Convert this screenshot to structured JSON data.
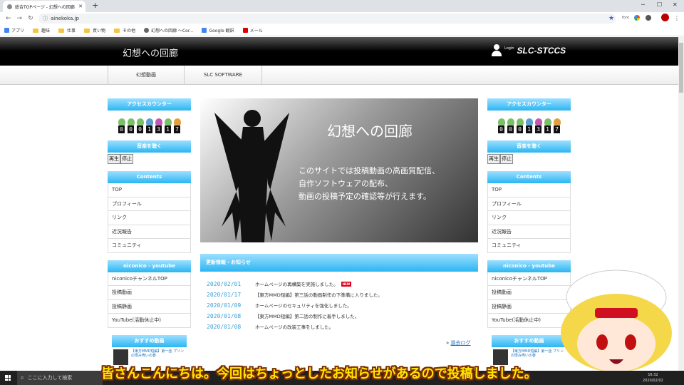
{
  "browser": {
    "tab_title": "総合TOPページ - 幻想への回廊",
    "url": "ainekoka.jp",
    "bookmarks": [
      "アプリ",
      "趣味",
      "仕事",
      "買い物",
      "その他",
      "幻想への回廊 〜Cor...",
      "Google 翻訳",
      "メール"
    ],
    "extension_text": "font"
  },
  "header": {
    "site_title": "幻想への回廊",
    "login_label": "Login",
    "username": "SLC-STCCS"
  },
  "nav": [
    "幻想動画",
    "SLC SOFTWARE"
  ],
  "sidebar": {
    "counter_title": "アクセスカウンター",
    "counter_digits": [
      "0",
      "0",
      "0",
      "1",
      "3",
      "1",
      "7"
    ],
    "music_title": "音楽を聴く",
    "music_play": "再生",
    "music_stop": "停止",
    "contents_title": "Contents",
    "contents": [
      "TOP",
      "プロフィール",
      "リンク",
      "近況報告",
      "コミュニティ"
    ],
    "video_title": "niconico - youtube",
    "video_links": [
      "niconicoチャンネルTOP",
      "投稿動画",
      "投稿静画",
      "YouTube(活動休止中)"
    ],
    "recommend_title": "おすすめ動画",
    "recommend_text": "【東方MMD短編】第一話 プリンの恨み怖いの巻"
  },
  "hero": {
    "title": "幻想への回廊",
    "lines": [
      "このサイトでは投稿動画の高画質配信、",
      "自作ソフトウェアの配布、",
      "動画の投稿予定の確認等が行えます。"
    ]
  },
  "news": {
    "title": "更新情報・お知らせ",
    "new_badge": "NEW",
    "items": [
      {
        "date": "2020/02/01",
        "text": "ホームページの再構築を実施しました。"
      },
      {
        "date": "2020/01/17",
        "text": "【東方MMD短編】第三話の動画制作の下準備に入りました。"
      },
      {
        "date": "2020/01/09",
        "text": "ホームページのセキュリティを強化しました。"
      },
      {
        "date": "2020/01/08",
        "text": "【東方MMD短編】第二話の制作に着手しました。"
      },
      {
        "date": "2020/01/08",
        "text": "ホームページの改装工事をしました。"
      }
    ],
    "past_log_prefix": "»",
    "past_log": "過去ログ"
  },
  "taskbar": {
    "search_placeholder": "ここに入力して検索",
    "time": "16:32",
    "date": "2020/02/02"
  },
  "subtitle": "皆さんこんにちは。今回はちょっとしたお知らせがあるので投稿しました。",
  "colors": {
    "accent": "#2bb5f2",
    "header_bg": "#000000",
    "subtitle": "#ffe600",
    "date_link": "#3aa0d8"
  },
  "icons": [
    "windows-logo-icon",
    "search-icon",
    "user-icon",
    "star-icon",
    "lock-icon"
  ]
}
